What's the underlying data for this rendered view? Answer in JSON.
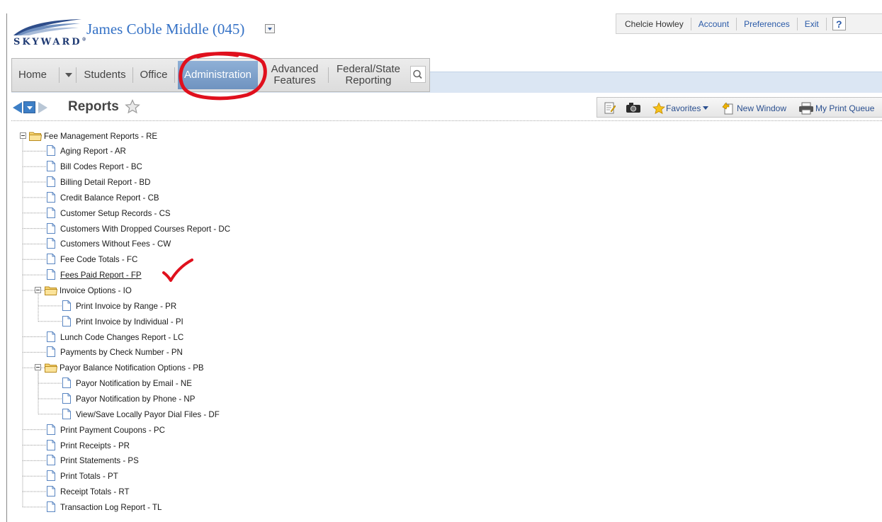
{
  "brand": {
    "logo_text": "SKYWARD"
  },
  "school": {
    "name": "James Coble Middle (045)"
  },
  "userbar": {
    "user": "Chelcie Howley",
    "account": "Account",
    "preferences": "Preferences",
    "exit": "Exit",
    "help": "?"
  },
  "nav": {
    "home": "Home",
    "students": "Students",
    "office": "Office",
    "administration": "Administration",
    "advanced_line1": "Advanced",
    "advanced_line2": "Features",
    "federal_line1": "Federal/State",
    "federal_line2": "Reporting",
    "active": "Administration"
  },
  "page": {
    "title": "Reports"
  },
  "toolbar": {
    "favorites": "Favorites",
    "new_window": "New Window",
    "print_queue": "My Print Queue"
  },
  "tree": {
    "root": "Fee Management Reports - RE",
    "items": [
      {
        "label": "Aging Report - AR",
        "level": 1,
        "type": "doc"
      },
      {
        "label": "Bill Codes Report - BC",
        "level": 1,
        "type": "doc"
      },
      {
        "label": "Billing Detail Report - BD",
        "level": 1,
        "type": "doc"
      },
      {
        "label": "Credit Balance Report - CB",
        "level": 1,
        "type": "doc"
      },
      {
        "label": "Customer Setup Records - CS",
        "level": 1,
        "type": "doc"
      },
      {
        "label": "Customers With Dropped Courses Report - DC",
        "level": 1,
        "type": "doc"
      },
      {
        "label": "Customers Without Fees - CW",
        "level": 1,
        "type": "doc"
      },
      {
        "label": "Fee Code Totals - FC",
        "level": 1,
        "type": "doc"
      },
      {
        "label": "Fees Paid Report - FP",
        "level": 1,
        "type": "doc",
        "underline": true
      },
      {
        "label": "Invoice Options - IO",
        "level": 1,
        "type": "folder"
      },
      {
        "label": "Print Invoice by Range - PR",
        "level": 2,
        "type": "doc"
      },
      {
        "label": "Print Invoice by Individual - PI",
        "level": 2,
        "type": "doc"
      },
      {
        "label": "Lunch Code Changes Report - LC",
        "level": 1,
        "type": "doc"
      },
      {
        "label": "Payments by Check Number - PN",
        "level": 1,
        "type": "doc"
      },
      {
        "label": "Payor Balance Notification Options - PB",
        "level": 1,
        "type": "folder"
      },
      {
        "label": "Payor Notification by Email - NE",
        "level": 2,
        "type": "doc"
      },
      {
        "label": "Payor Notification by Phone - NP",
        "level": 2,
        "type": "doc"
      },
      {
        "label": "View/Save Locally Payor Dial Files - DF",
        "level": 2,
        "type": "doc"
      },
      {
        "label": "Print Payment Coupons - PC",
        "level": 1,
        "type": "doc"
      },
      {
        "label": "Print Receipts - PR",
        "level": 1,
        "type": "doc"
      },
      {
        "label": "Print Statements - PS",
        "level": 1,
        "type": "doc"
      },
      {
        "label": "Print Totals - PT",
        "level": 1,
        "type": "doc"
      },
      {
        "label": "Receipt Totals - RT",
        "level": 1,
        "type": "doc"
      },
      {
        "label": "Transaction Log Report - TL",
        "level": 1,
        "type": "doc"
      }
    ]
  },
  "colors": {
    "accent": "#3572c6",
    "active_tab": "#7c9ecb",
    "annotation_red": "#e0101d"
  }
}
